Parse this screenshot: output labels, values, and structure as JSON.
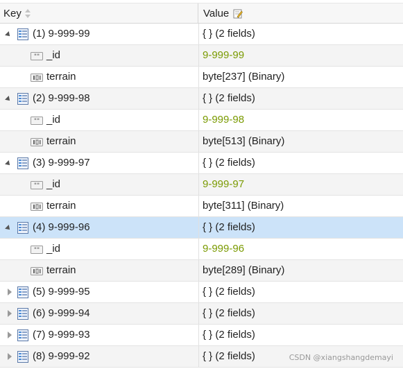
{
  "header": {
    "key_label": "Key",
    "value_label": "Value"
  },
  "rows": [
    {
      "kind": "doc",
      "expanded": true,
      "key": "(1) 9-999-99",
      "value": "{ } (2 fields)"
    },
    {
      "kind": "string",
      "key": "_id",
      "value": "9-999-99"
    },
    {
      "kind": "binary",
      "key": "terrain",
      "value": "byte[237] (Binary)"
    },
    {
      "kind": "doc",
      "expanded": true,
      "key": "(2) 9-999-98",
      "value": "{ } (2 fields)"
    },
    {
      "kind": "string",
      "key": "_id",
      "value": "9-999-98"
    },
    {
      "kind": "binary",
      "key": "terrain",
      "value": "byte[513] (Binary)"
    },
    {
      "kind": "doc",
      "expanded": true,
      "key": "(3) 9-999-97",
      "value": "{ } (2 fields)"
    },
    {
      "kind": "string",
      "key": "_id",
      "value": "9-999-97"
    },
    {
      "kind": "binary",
      "key": "terrain",
      "value": "byte[311] (Binary)"
    },
    {
      "kind": "doc",
      "expanded": true,
      "selected": true,
      "key": "(4) 9-999-96",
      "value": "{ } (2 fields)"
    },
    {
      "kind": "string",
      "key": "_id",
      "value": "9-999-96"
    },
    {
      "kind": "binary",
      "key": "terrain",
      "value": "byte[289] (Binary)"
    },
    {
      "kind": "doc",
      "expanded": false,
      "key": "(5) 9-999-95",
      "value": "{ } (2 fields)"
    },
    {
      "kind": "doc",
      "expanded": false,
      "key": "(6) 9-999-94",
      "value": "{ } (2 fields)"
    },
    {
      "kind": "doc",
      "expanded": false,
      "key": "(7) 9-999-93",
      "value": "{ } (2 fields)"
    },
    {
      "kind": "doc",
      "expanded": false,
      "key": "(8) 9-999-92",
      "value": "{ } (2 fields)"
    }
  ],
  "colors": {
    "selected_row": "#cce3f9",
    "id_value": "#7a9a00"
  },
  "watermark": "CSDN @xiangshangdemayi"
}
